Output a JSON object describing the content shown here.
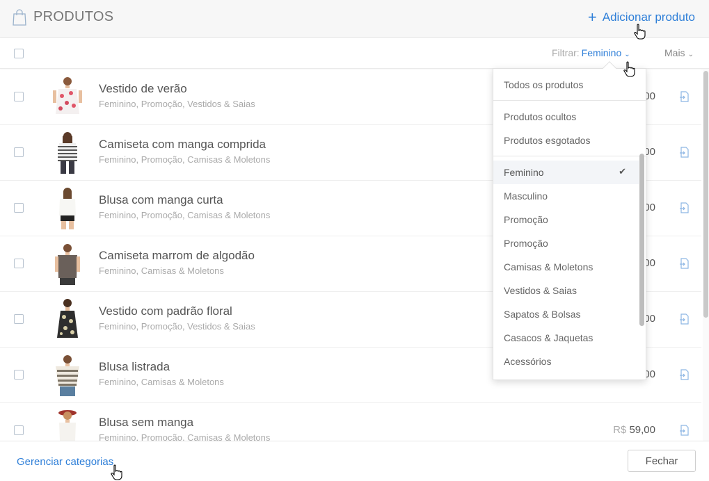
{
  "header": {
    "title": "PRODUTOS",
    "add_label": "Adicionar produto"
  },
  "toolbar": {
    "filter_label": "Filtrar:",
    "filter_value": "Feminino",
    "more_label": "Mais"
  },
  "products": [
    {
      "name": "Vestido de verão",
      "categories": "Feminino, Promoção, Vestidos & Saias",
      "price": "00"
    },
    {
      "name": "Camiseta com manga comprida",
      "categories": "Feminino, Promoção, Camisas & Moletons",
      "price": "00"
    },
    {
      "name": "Blusa com manga curta",
      "categories": "Feminino, Promoção, Camisas & Moletons",
      "price": "00"
    },
    {
      "name": "Camiseta marrom de algodão",
      "categories": "Feminino, Camisas & Moletons",
      "price": "00"
    },
    {
      "name": "Vestido com padrão floral",
      "categories": "Feminino, Promoção, Vestidos & Saias",
      "price": "00"
    },
    {
      "name": "Blusa listrada",
      "categories": "Feminino, Camisas & Moletons",
      "price": "00"
    },
    {
      "name": "Blusa sem manga",
      "categories": "Feminino, Promoção, Camisas & Moletons",
      "currency": "R$",
      "price": "59,00"
    }
  ],
  "dropdown": {
    "items": [
      "Todos os produtos",
      "Produtos ocultos",
      "Produtos esgotados",
      "Feminino",
      "Masculino",
      "Promoção",
      "Promoção",
      "Camisas & Moletons",
      "Vestidos & Saias",
      "Sapatos & Bolsas",
      "Casacos & Jaquetas",
      "Acessórios"
    ],
    "selected": "Feminino",
    "check": "✔"
  },
  "footer": {
    "manage_label": "Gerenciar categorias",
    "close_label": "Fechar"
  },
  "colors": {
    "accent": "#2f7fd8",
    "header_bg": "#f7f7f7",
    "text": "#555555",
    "muted": "#aaaaaa"
  }
}
